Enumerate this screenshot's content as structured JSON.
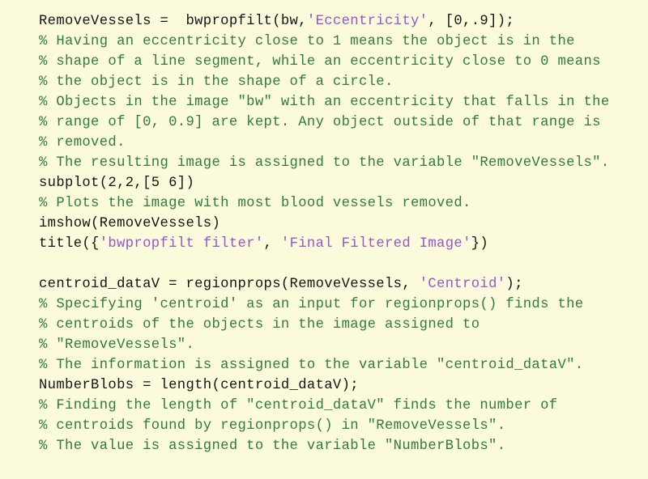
{
  "editor": {
    "language": "MATLAB",
    "background_color": "#fcfcdc",
    "code_color": "#141414",
    "comment_color": "#2f7d3a",
    "string_color": "#9a55c7",
    "lines": [
      {
        "index": 1,
        "kind": "code",
        "text": "RemoveVessels =  bwpropfilt(bw,'Eccentricity', [0,.9]);",
        "tokens": [
          {
            "type": "plain",
            "text": "RemoveVessels =  bwpropfilt(bw,"
          },
          {
            "type": "string",
            "text": "'Eccentricity'"
          },
          {
            "type": "plain",
            "text": ", [0,.9]);"
          }
        ]
      },
      {
        "index": 2,
        "kind": "comment",
        "text": "% Having an eccentricity close to 1 means the object is in the",
        "tokens": [
          {
            "type": "comment",
            "text": "% Having an eccentricity close to 1 means the object is in the"
          }
        ]
      },
      {
        "index": 3,
        "kind": "comment",
        "text": "% shape of a line segment, while an eccentricity close to 0 means",
        "tokens": [
          {
            "type": "comment",
            "text": "% shape of a line segment, while an eccentricity close to 0 means"
          }
        ]
      },
      {
        "index": 4,
        "kind": "comment",
        "text": "% the object is in the shape of a circle.",
        "tokens": [
          {
            "type": "comment",
            "text": "% the object is in the shape of a circle."
          }
        ]
      },
      {
        "index": 5,
        "kind": "comment",
        "text": "% Objects in the image \"bw\" with an eccentricity that falls in the",
        "tokens": [
          {
            "type": "comment",
            "text": "% Objects in the image \"bw\" with an eccentricity that falls in the"
          }
        ]
      },
      {
        "index": 6,
        "kind": "comment",
        "text": "% range of [0, 0.9] are kept. Any object outside of that range is",
        "tokens": [
          {
            "type": "comment",
            "text": "% range of [0, 0.9] are kept. Any object outside of that range is"
          }
        ]
      },
      {
        "index": 7,
        "kind": "comment",
        "text": "% removed.",
        "tokens": [
          {
            "type": "comment",
            "text": "% removed."
          }
        ]
      },
      {
        "index": 8,
        "kind": "comment",
        "text": "% The resulting image is assigned to the variable \"RemoveVessels\".",
        "tokens": [
          {
            "type": "comment",
            "text": "% The resulting image is assigned to the variable \"RemoveVessels\"."
          }
        ]
      },
      {
        "index": 9,
        "kind": "code",
        "text": "subplot(2,2,[5 6])",
        "tokens": [
          {
            "type": "plain",
            "text": "subplot(2,2,[5 6])"
          }
        ]
      },
      {
        "index": 10,
        "kind": "comment",
        "text": "% Plots the image with most blood vessels removed.",
        "tokens": [
          {
            "type": "comment",
            "text": "% Plots the image with most blood vessels removed."
          }
        ]
      },
      {
        "index": 11,
        "kind": "code",
        "text": "imshow(RemoveVessels)",
        "tokens": [
          {
            "type": "plain",
            "text": "imshow(RemoveVessels)"
          }
        ]
      },
      {
        "index": 12,
        "kind": "code",
        "text": "title({'bwpropfilt filter', 'Final Filtered Image'})",
        "tokens": [
          {
            "type": "plain",
            "text": "title({"
          },
          {
            "type": "string",
            "text": "'bwpropfilt filter'"
          },
          {
            "type": "plain",
            "text": ", "
          },
          {
            "type": "string",
            "text": "'Final Filtered Image'"
          },
          {
            "type": "plain",
            "text": "})"
          }
        ]
      },
      {
        "index": 13,
        "kind": "blank",
        "text": "",
        "tokens": []
      },
      {
        "index": 14,
        "kind": "code",
        "text": "centroid_dataV = regionprops(RemoveVessels, 'Centroid');",
        "tokens": [
          {
            "type": "plain",
            "text": "centroid_dataV = regionprops(RemoveVessels, "
          },
          {
            "type": "string",
            "text": "'Centroid'"
          },
          {
            "type": "plain",
            "text": ");"
          }
        ]
      },
      {
        "index": 15,
        "kind": "comment",
        "text": "% Specifying 'centroid' as an input for regionprops() finds the",
        "tokens": [
          {
            "type": "comment",
            "text": "% Specifying 'centroid' as an input for regionprops() finds the"
          }
        ]
      },
      {
        "index": 16,
        "kind": "comment",
        "text": "% centroids of the objects in the image assigned to",
        "tokens": [
          {
            "type": "comment",
            "text": "% centroids of the objects in the image assigned to"
          }
        ]
      },
      {
        "index": 17,
        "kind": "comment",
        "text": "% \"RemoveVessels\".",
        "tokens": [
          {
            "type": "comment",
            "text": "% \"RemoveVessels\"."
          }
        ]
      },
      {
        "index": 18,
        "kind": "comment",
        "text": "% The information is assigned to the variable \"centroid_dataV\".",
        "tokens": [
          {
            "type": "comment",
            "text": "% The information is assigned to the variable \"centroid_dataV\"."
          }
        ]
      },
      {
        "index": 19,
        "kind": "code",
        "text": "NumberBlobs = length(centroid_dataV);",
        "tokens": [
          {
            "type": "plain",
            "text": "NumberBlobs = length(centroid_dataV);"
          }
        ]
      },
      {
        "index": 20,
        "kind": "comment",
        "text": "% Finding the length of \"centroid_dataV\" finds the number of",
        "tokens": [
          {
            "type": "comment",
            "text": "% Finding the length of \"centroid_dataV\" finds the number of"
          }
        ]
      },
      {
        "index": 21,
        "kind": "comment",
        "text": "% centroids found by regionprops() in \"RemoveVessels\".",
        "tokens": [
          {
            "type": "comment",
            "text": "% centroids found by regionprops() in \"RemoveVessels\"."
          }
        ]
      },
      {
        "index": 22,
        "kind": "comment",
        "text": "% The value is assigned to the variable \"NumberBlobs\".",
        "tokens": [
          {
            "type": "comment",
            "text": "% The value is assigned to the variable \"NumberBlobs\"."
          }
        ]
      }
    ]
  }
}
